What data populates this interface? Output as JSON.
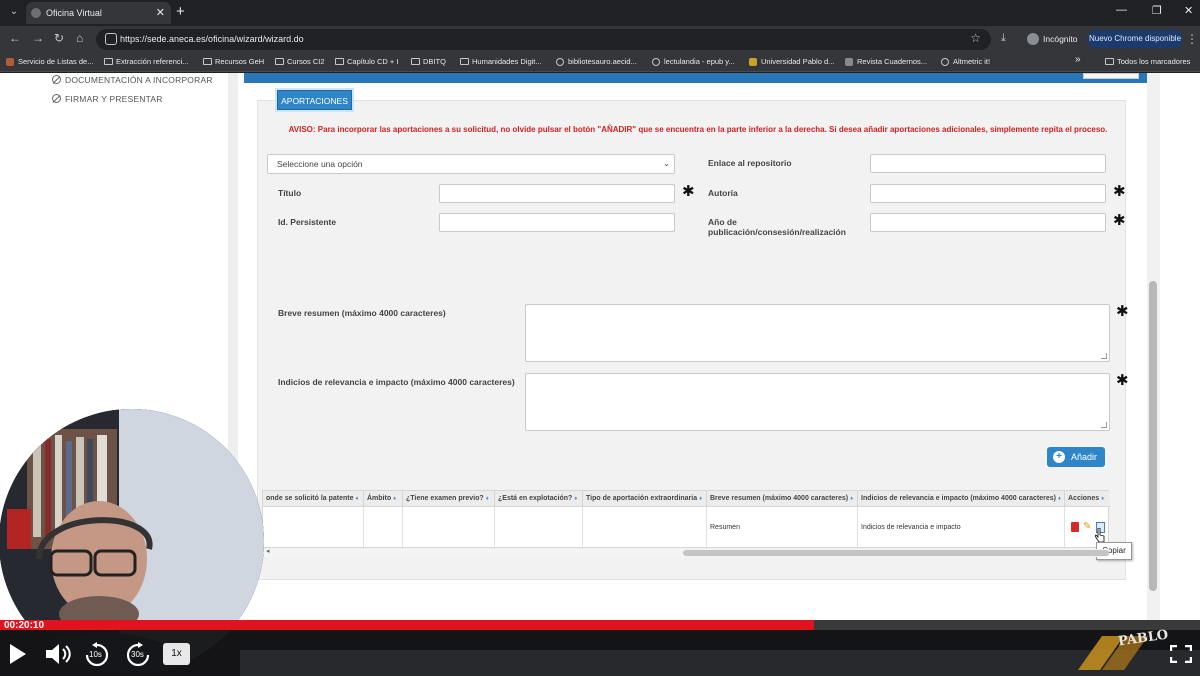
{
  "browser": {
    "tab_title": "Oficina Virtual",
    "url": "https://sede.aneca.es/oficina/wizard/wizard.do",
    "incognito_label": "Incógnito",
    "update_button": "Nuevo Chrome disponible",
    "bookmarks": [
      "Servicio de Listas de...",
      "Extracción referenci...",
      "Recursos GeH",
      "Cursos CI2",
      "Capítulo CD + I",
      "DBITQ",
      "Humanidades Digit...",
      "bibliotesauro.aecid...",
      "lectulandia - epub y...",
      "Universidad Pablo d...",
      "Revista Cuadernos...",
      "Altmetric it!"
    ],
    "all_bookmarks": "Todos los marcadores"
  },
  "sidebar": {
    "items": [
      {
        "label": "DOCUMENTACIÓN A INCORPORAR"
      },
      {
        "label": "FIRMAR Y PRESENTAR"
      }
    ]
  },
  "form": {
    "section_tab": "APORTACIONES",
    "notice": "AVISO: Para incorporar las aportaciones  a su solicitud, no olvide pulsar el botón \"AÑADIR\" que se encuentra en la parte inferior a la derecha. Si desea añadir aportaciones adicionales, simplemente repita el proceso.",
    "select_value": "Seleccione una opción",
    "labels": {
      "enlace": "Enlace al repositorio",
      "titulo": "Título",
      "autoria": "Autoría",
      "id_persistente": "Id. Persistente",
      "anio": "Año de publicación/consesión/realización",
      "resumen": "Breve resumen (máximo 4000 caracteres)",
      "indicios": "Indicios de relevancia e impacto (máximo 4000 caracteres)"
    },
    "required_mark": "✱",
    "add_button": "Añadir"
  },
  "table": {
    "columns": [
      "onde se solicitó la patente",
      "Ámbito",
      "¿Tiene examen previo?",
      "¿Está en explotación?",
      "Tipo de aportación extraordinaria",
      "Breve resumen (máximo 4000 caracteres)",
      "Indicios de relevancia e impacto (máximo 4000 caracteres)",
      "Acciones"
    ],
    "sort_glyph": "♦",
    "row": {
      "resumen": "Resumen",
      "indicios": "Indicios de relevancia e impacto"
    },
    "tooltip": "Copiar",
    "scroll_left_glyph": "◂"
  },
  "player": {
    "timecode": "00:20:10",
    "progress_percent": 67.8,
    "rewind_label": "10s",
    "forward_label": "30s",
    "speed_label": "1x"
  },
  "icons": {
    "tab_close": "close-icon",
    "new_tab": "plus-icon",
    "back": "arrow-left-icon",
    "forward": "arrow-right-icon",
    "reload": "reload-icon",
    "home": "home-icon",
    "star": "star-icon",
    "download": "download-icon",
    "delete": "trash-icon",
    "edit": "pencil-icon",
    "copy": "copy-icon"
  },
  "colors": {
    "accent_blue": "#2e86c9",
    "notice_red": "#d32121",
    "progress_red": "#e0141e",
    "delete_red": "#d42a2a",
    "edit_yellow": "#e0a100"
  }
}
